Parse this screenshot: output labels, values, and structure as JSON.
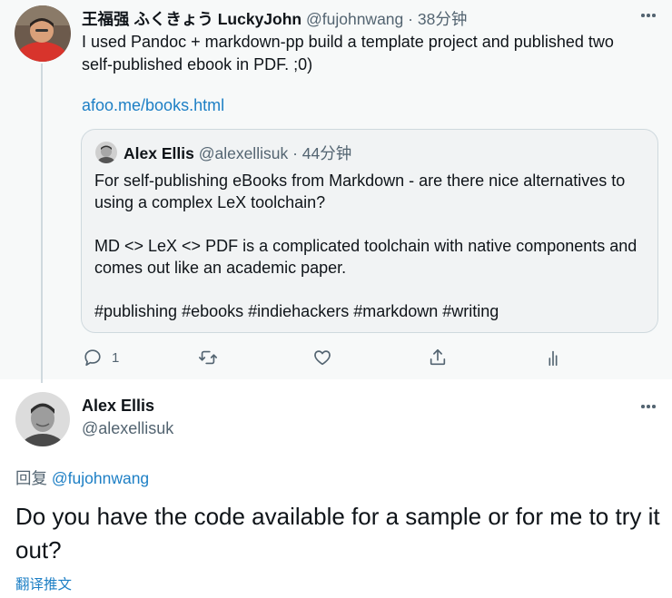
{
  "parent_tweet": {
    "author_name": "王福强 ふくきょう LuckyJohn",
    "author_handle": "@fujohnwang",
    "separator": "·",
    "time": "38分钟",
    "text": "I used Pandoc + markdown-pp build a template project and published two\nself-published ebook in PDF. ;0)",
    "link": "afoo.me/books.html",
    "quote": {
      "author_name": "Alex Ellis",
      "author_handle": "@alexellisuk",
      "separator": "·",
      "time": "44分钟",
      "paragraphs": [
        "For self-publishing eBooks from Markdown - are there nice alternatives to using a complex LeX toolchain?",
        "MD <> LeX <> PDF is a complicated toolchain with native components and comes out like an academic paper.",
        "#publishing #ebooks #indiehackers #markdown #writing"
      ]
    },
    "actions": {
      "reply_count": "1"
    }
  },
  "reply_tweet": {
    "author_name": "Alex Ellis",
    "author_handle": "@alexellisuk",
    "replying_prefix": "回复",
    "replying_to": "@fujohnwang",
    "text": "Do you have the code available for a sample or for me to try it out?",
    "translate_label": "翻译推文"
  },
  "icons": [
    "more-icon",
    "reply-icon",
    "retweet-icon",
    "like-icon",
    "share-icon",
    "analytics-icon"
  ],
  "colors": {
    "accent": "#1d7fc5",
    "muted": "#536471",
    "text": "#0f1419",
    "parent_bg": "#f7f9f9",
    "border": "#cfd9de"
  }
}
